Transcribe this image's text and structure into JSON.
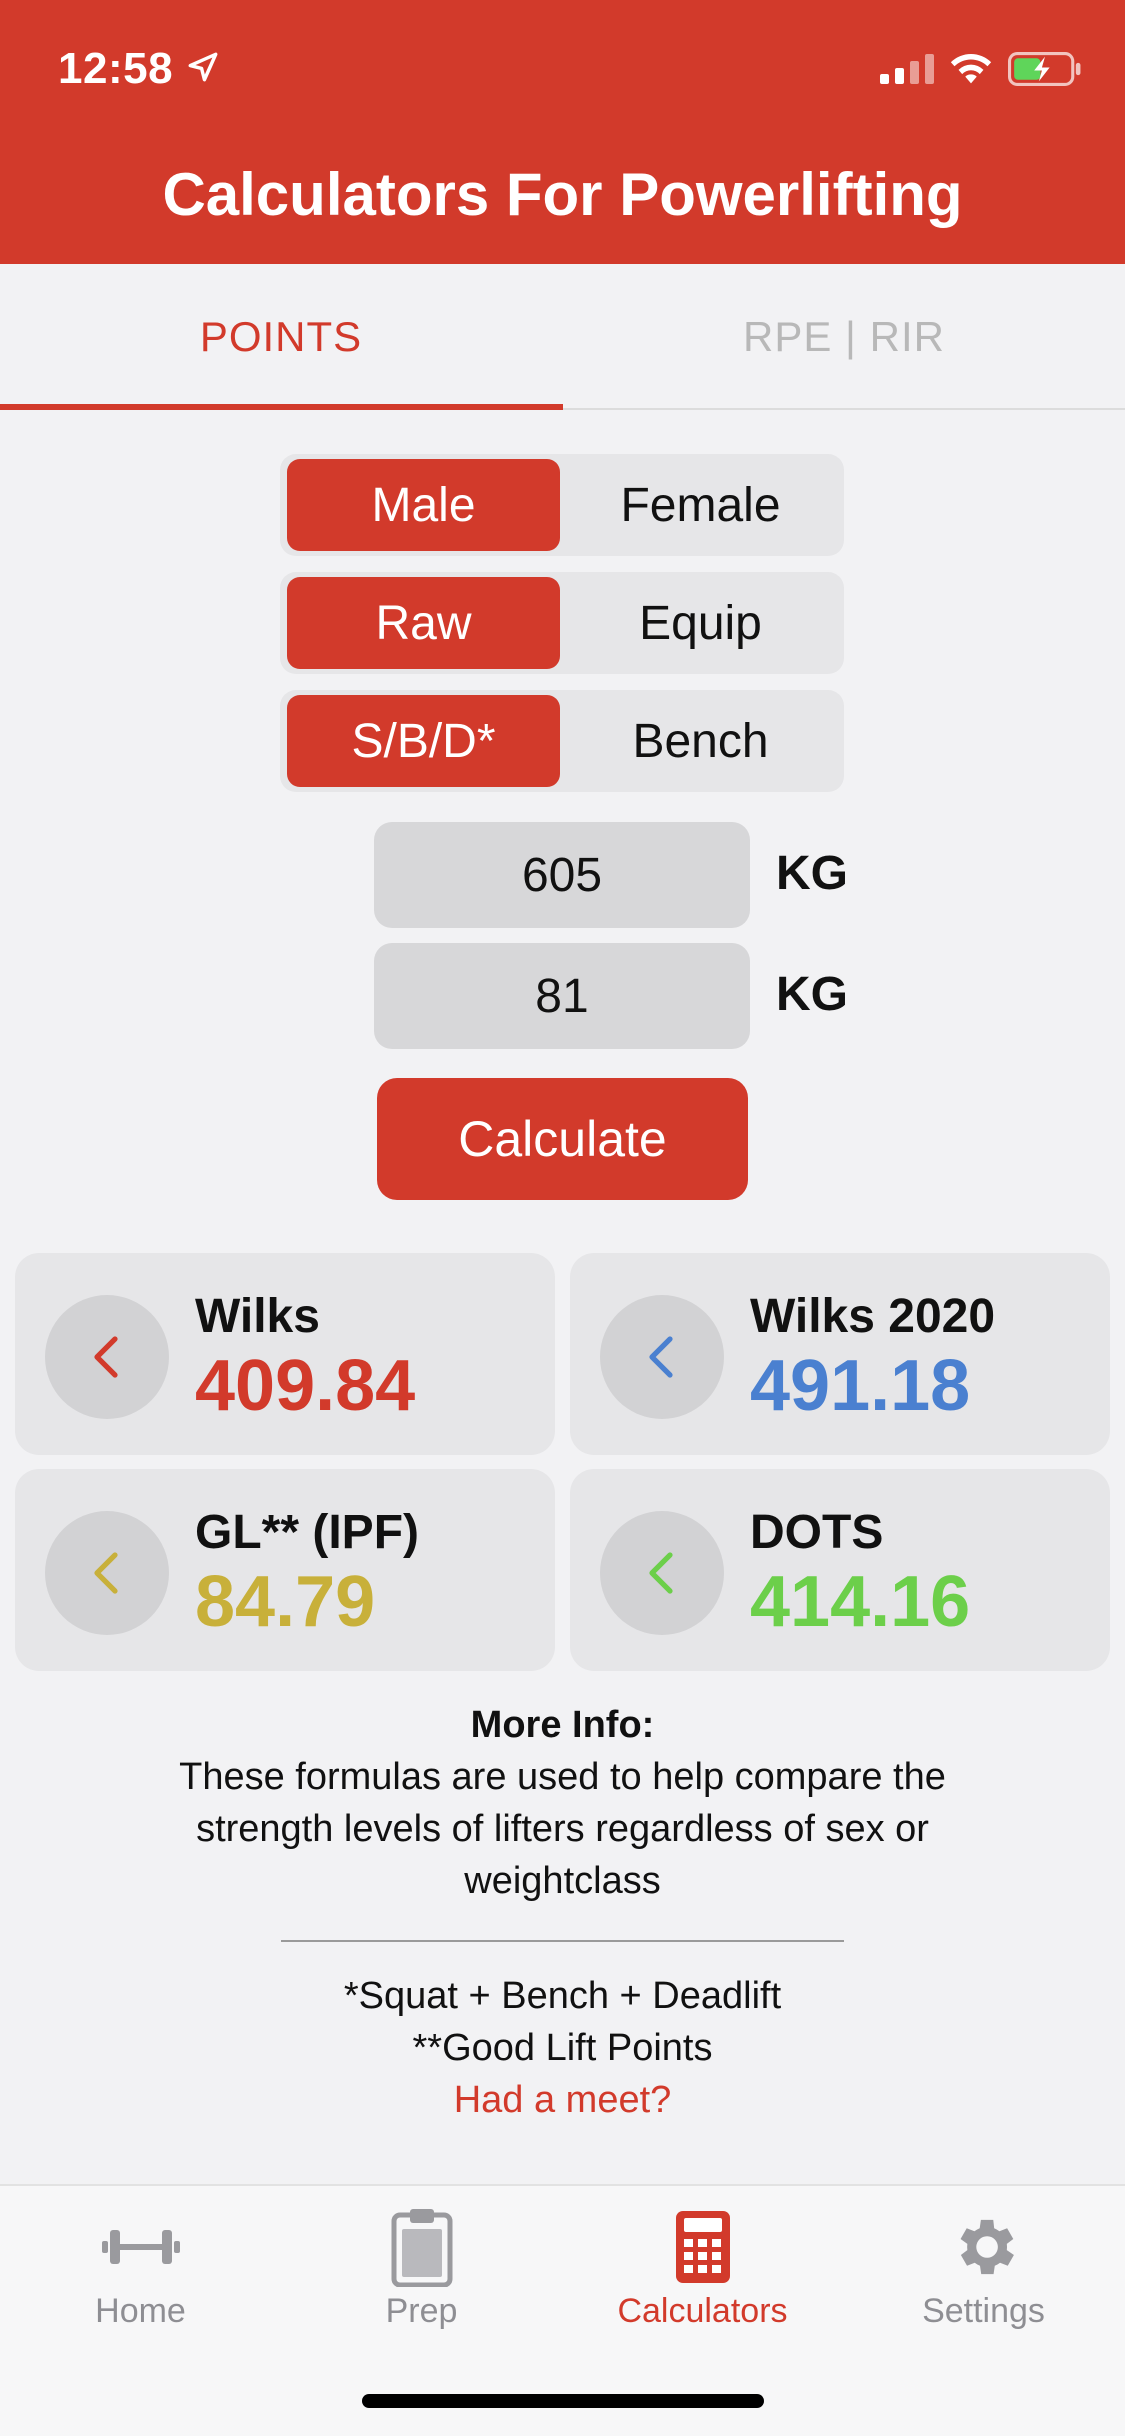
{
  "status_bar": {
    "time": "12:58"
  },
  "header": {
    "title": "Calculators For Powerlifting"
  },
  "tabs": [
    {
      "label": "POINTS",
      "active": true
    },
    {
      "label": "RPE | RIR",
      "active": false
    }
  ],
  "segments": {
    "sex": {
      "options": [
        "Male",
        "Female"
      ],
      "selected": "Male"
    },
    "equipment": {
      "options": [
        "Raw",
        "Equip"
      ],
      "selected": "Raw"
    },
    "lift": {
      "options": [
        "S/B/D*",
        "Bench"
      ],
      "selected": "S/B/D*"
    }
  },
  "inputs": {
    "total": {
      "value": "605",
      "unit": "KG"
    },
    "bodyweight": {
      "value": "81",
      "unit": "KG"
    }
  },
  "calculate_label": "Calculate",
  "results": [
    {
      "label": "Wilks",
      "value": "409.84",
      "color": "#d23a2b",
      "icon": "chevron-left-icon"
    },
    {
      "label": "Wilks 2020",
      "value": "491.18",
      "color": "#4a80d0",
      "icon": "chevron-left-icon"
    },
    {
      "label": "GL** (IPF)",
      "value": "84.79",
      "color": "#c8b03a",
      "icon": "chevron-left-icon"
    },
    {
      "label": "DOTS",
      "value": "414.16",
      "color": "#6ccf4a",
      "icon": "chevron-left-icon"
    }
  ],
  "info": {
    "title": "More Info:",
    "text": "These formulas are used to help compare the strength levels of lifters regardless of sex or weightclass",
    "footnote1": "*Squat + Bench + Deadlift",
    "footnote2": "**Good Lift Points",
    "link": "Had a meet?"
  },
  "tabbar": [
    {
      "label": "Home",
      "icon": "barbell-icon",
      "active": false
    },
    {
      "label": "Prep",
      "icon": "clipboard-icon",
      "active": false
    },
    {
      "label": "Calculators",
      "icon": "calculator-icon",
      "active": true
    },
    {
      "label": "Settings",
      "icon": "gear-icon",
      "active": false
    }
  ],
  "colors": {
    "accent": "#d23a2b",
    "inactive": "#8e8e93"
  }
}
